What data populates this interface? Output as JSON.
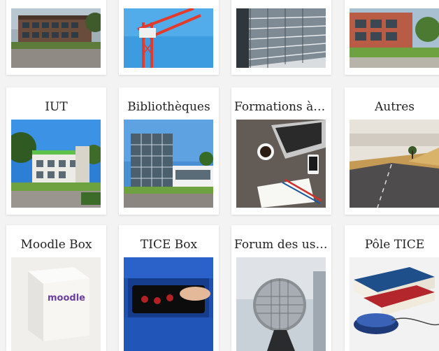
{
  "tiles": [
    {
      "id": "row1-1",
      "title": ""
    },
    {
      "id": "row1-2",
      "title": ""
    },
    {
      "id": "row1-3",
      "title": ""
    },
    {
      "id": "row1-4",
      "title": ""
    },
    {
      "id": "iut",
      "title": "IUT"
    },
    {
      "id": "bibliotheques",
      "title": "Bibliothèques"
    },
    {
      "id": "formations",
      "title": "Formations à d..."
    },
    {
      "id": "autres",
      "title": "Autres"
    },
    {
      "id": "moodle-box",
      "title": "Moodle Box"
    },
    {
      "id": "tice-box",
      "title": "TICE Box"
    },
    {
      "id": "forum",
      "title": "Forum des usa..."
    },
    {
      "id": "pole-tice",
      "title": "Pôle TICE"
    }
  ],
  "box_label": "moodle"
}
